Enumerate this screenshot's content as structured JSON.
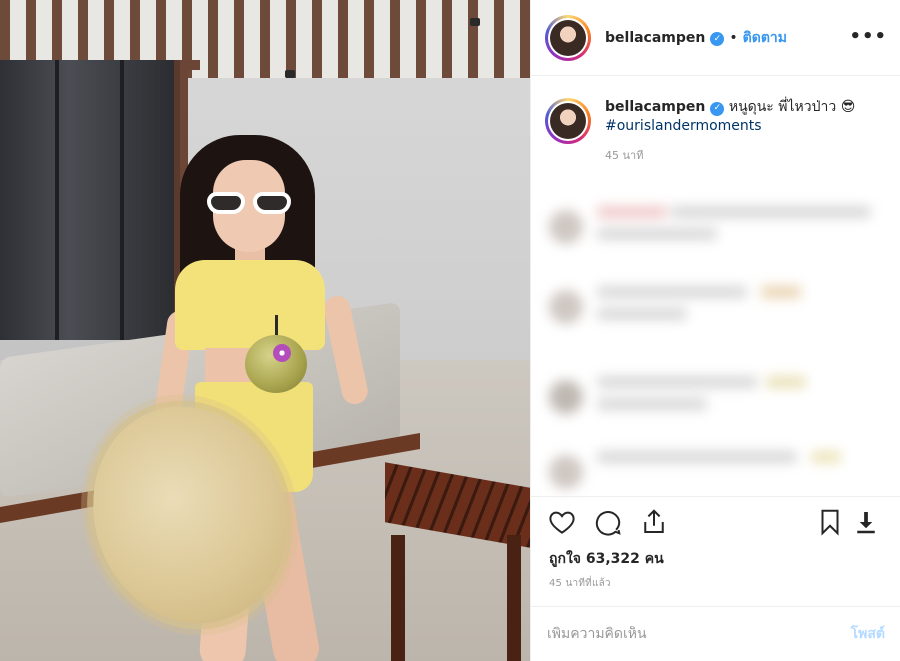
{
  "post": {
    "username": "bellacampen",
    "follow_label": "ติดตาม",
    "more_label": "•••",
    "caption_text": "หนูดุนะ พี่ไหวป่าว 😎",
    "hashtag": "#ourislandermoments",
    "caption_time": "45 นาที",
    "likes": "ถูกใจ 63,322 คน",
    "post_time": "45 นาทีที่แล้ว",
    "comment_placeholder": "เพิ่มความคิดเห็น",
    "post_button": "โพสต์"
  },
  "colors": {
    "accent": "#3897f0",
    "hashtag": "#003569",
    "muted": "#999999",
    "post_disabled": "#b3dbff"
  },
  "icons": {
    "actions": [
      "heart-icon",
      "comment-icon",
      "share-icon",
      "bookmark-icon",
      "download-icon"
    ]
  }
}
